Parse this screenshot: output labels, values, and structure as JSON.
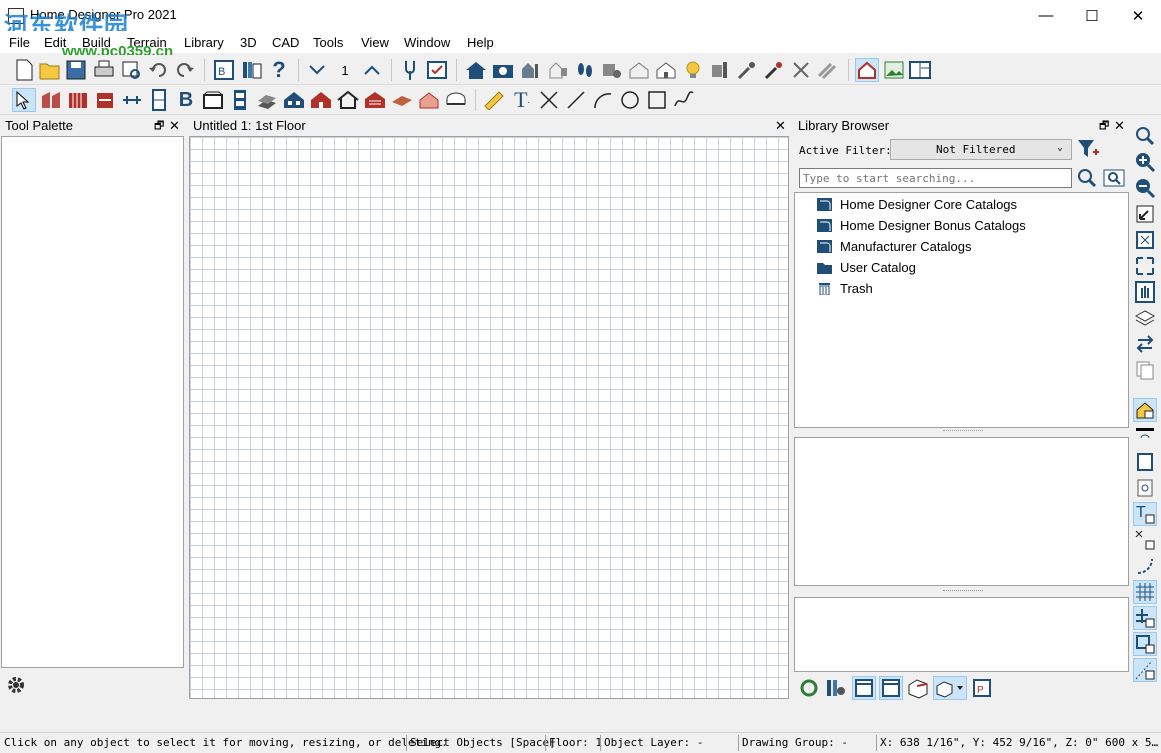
{
  "window": {
    "title": "Home Designer Pro 2021",
    "minimize": "—",
    "maximize": "☐",
    "close": "✕"
  },
  "watermark": {
    "line1": "河东软件园",
    "line2": "www.pc0359.cn"
  },
  "menu": [
    "File",
    "Edit",
    "Build",
    "Terrain",
    "Library",
    "3D",
    "CAD",
    "Tools",
    "View",
    "Window",
    "Help"
  ],
  "toolbar": {
    "floor_value": "1"
  },
  "tool_palette": {
    "title": "Tool Palette",
    "restore": "🗗",
    "close": "✕"
  },
  "document": {
    "title": "Untitled 1: 1st Floor",
    "close": "✕"
  },
  "library": {
    "title": "Library Browser",
    "restore": "🗗",
    "close": "✕",
    "filter_label": "Active Filter:",
    "filter_value": "Not Filtered",
    "search_placeholder": "Type to start searching...",
    "items": [
      {
        "label": "Home Designer Core Catalogs",
        "icon": "catalog-icon"
      },
      {
        "label": "Home Designer Bonus Catalogs",
        "icon": "catalog-icon"
      },
      {
        "label": "Manufacturer Catalogs",
        "icon": "catalog-icon"
      },
      {
        "label": "User Catalog",
        "icon": "folder-icon"
      },
      {
        "label": "Trash",
        "icon": "trash-icon"
      }
    ]
  },
  "status": {
    "hint": "Click on any object to select it for moving, resizing, or deleting.",
    "mode": "Select Objects [Space]",
    "floor": "Floor: 1",
    "layer": "Object Layer: -",
    "group": "Drawing Group: -",
    "coords": "X: 638 1/16\", Y: 452 9/16\", Z: 0\" 600 x 5…"
  },
  "colors": {
    "accent": "#1f4e79",
    "house_red": "#b0302a",
    "select_blue": "#cce4f7"
  }
}
